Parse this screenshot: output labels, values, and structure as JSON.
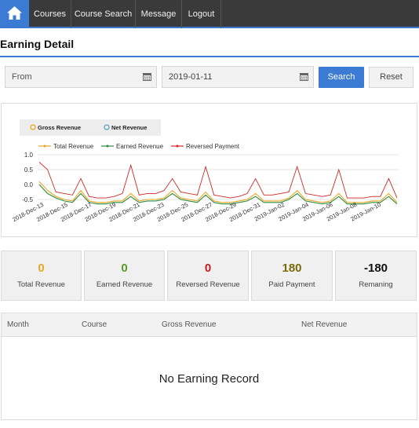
{
  "nav": {
    "home_icon": "home-icon",
    "items": [
      {
        "label": "Courses"
      },
      {
        "label": "Course Search"
      },
      {
        "label": "Message"
      },
      {
        "label": "Logout"
      }
    ]
  },
  "page": {
    "title": "Earning Detail"
  },
  "filters": {
    "from_placeholder": "From",
    "to_value": "2019-01-11",
    "calendar_icon": "calendar-icon",
    "search_label": "Search",
    "reset_label": "Reset"
  },
  "colors": {
    "accent": "#3b7bd4",
    "nav_bg": "#3a3a3a",
    "total_revenue": "#e6a824",
    "earned_revenue": "#2e8b3e",
    "reversed_payment": "#cc2a2a",
    "gross_revenue": "#e6a824",
    "net_revenue": "#5aa5b5",
    "paid_payment": "#7a6a0a"
  },
  "chart_data": {
    "type": "line",
    "toggle_legend": [
      "Gross Revenue",
      "Net Revenue"
    ],
    "legend": [
      "Total Revenue",
      "Earned Revenue",
      "Reversed Payment"
    ],
    "ylim": [
      -0.5,
      1.0
    ],
    "yticks": [
      "1.0",
      "0.5",
      "0.0",
      "-0.5"
    ],
    "xtick_labels": [
      "2018-Dec-13",
      "2018-Dec-15",
      "2018-Dec-17",
      "2018-Dec-19",
      "2018-Dec-21",
      "2018-Dec-23",
      "2018-Dec-25",
      "2018-Dec-27",
      "2018-Dec-29",
      "2018-Dec-31",
      "2019-Jan-02",
      "2019-Jan-04",
      "2019-Jan-06",
      "2019-Jan-08",
      "2019-Jan-10"
    ],
    "series": [
      {
        "name": "Total Revenue",
        "values": [
          0.1,
          -0.2,
          -0.4,
          -0.5,
          -0.55,
          -0.2,
          -0.55,
          -0.6,
          -0.6,
          -0.55,
          -0.55,
          -0.3,
          -0.55,
          -0.5,
          -0.5,
          -0.45,
          -0.2,
          -0.45,
          -0.5,
          -0.55,
          -0.25,
          -0.55,
          -0.6,
          -0.6,
          -0.55,
          -0.5,
          -0.3,
          -0.55,
          -0.55,
          -0.55,
          -0.45,
          -0.2,
          -0.5,
          -0.55,
          -0.6,
          -0.55,
          -0.3,
          -0.6,
          -0.6,
          -0.6,
          -0.55,
          -0.55,
          -0.3,
          -0.6
        ]
      },
      {
        "name": "Earned Revenue",
        "values": [
          0.0,
          -0.3,
          -0.45,
          -0.55,
          -0.6,
          -0.3,
          -0.6,
          -0.65,
          -0.65,
          -0.6,
          -0.6,
          -0.4,
          -0.6,
          -0.55,
          -0.55,
          -0.5,
          -0.3,
          -0.5,
          -0.55,
          -0.6,
          -0.35,
          -0.6,
          -0.65,
          -0.65,
          -0.6,
          -0.55,
          -0.4,
          -0.6,
          -0.6,
          -0.6,
          -0.5,
          -0.3,
          -0.55,
          -0.6,
          -0.65,
          -0.6,
          -0.4,
          -0.65,
          -0.65,
          -0.65,
          -0.6,
          -0.6,
          -0.4,
          -0.65
        ]
      },
      {
        "name": "Reversed Payment",
        "values": [
          0.75,
          0.5,
          -0.25,
          -0.3,
          -0.35,
          0.2,
          -0.4,
          -0.45,
          -0.45,
          -0.4,
          -0.3,
          0.65,
          -0.35,
          -0.3,
          -0.3,
          -0.2,
          0.2,
          -0.25,
          -0.3,
          -0.35,
          0.6,
          -0.35,
          -0.4,
          -0.45,
          -0.4,
          -0.3,
          0.2,
          -0.35,
          -0.35,
          -0.3,
          -0.25,
          0.6,
          -0.3,
          -0.35,
          -0.4,
          -0.35,
          0.5,
          -0.45,
          -0.45,
          -0.45,
          -0.4,
          -0.4,
          0.2,
          -0.45
        ]
      }
    ]
  },
  "stats": [
    {
      "value": "0",
      "label": "Total Revenue",
      "color": "#e6a824"
    },
    {
      "value": "0",
      "label": "Earned Revenue",
      "color": "#5a9a2a"
    },
    {
      "value": "0",
      "label": "Reversed Revenue",
      "color": "#cc1a1a"
    },
    {
      "value": "180",
      "label": "Paid Payment",
      "color": "#7a6a0a"
    },
    {
      "value": "-180",
      "label": "Remaning",
      "color": "#111111"
    }
  ],
  "table": {
    "columns": [
      "Month",
      "Course",
      "Gross Revenue",
      "Net Revenue"
    ],
    "empty_text": "No Earning Record"
  }
}
